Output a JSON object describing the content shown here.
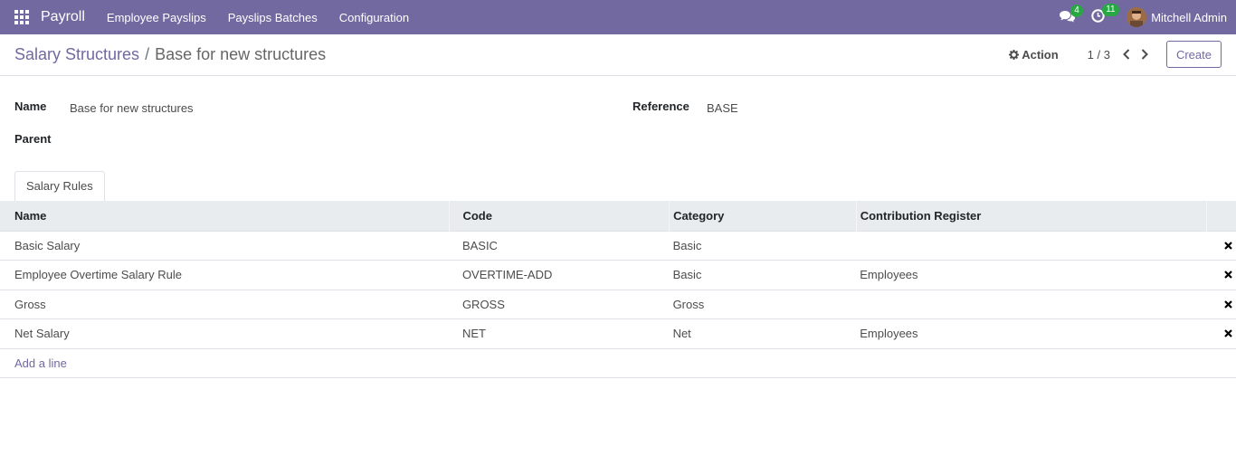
{
  "navbar": {
    "brand": "Payroll",
    "menu": [
      "Employee Payslips",
      "Payslips Batches",
      "Configuration"
    ],
    "messages_count": "4",
    "activities_count": "11",
    "user": "Mitchell Admin"
  },
  "control_panel": {
    "breadcrumb_parent": "Salary Structures",
    "breadcrumb_separator": "/",
    "breadcrumb_current": "Base for new structures",
    "action_label": "Action",
    "pager": "1 / 3",
    "create_label": "Create"
  },
  "form": {
    "name_label": "Name",
    "name_value": "Base for new structures",
    "parent_label": "Parent",
    "reference_label": "Reference",
    "reference_value": "BASE"
  },
  "tabs": [
    "Salary Rules"
  ],
  "table": {
    "columns": [
      "Name",
      "Code",
      "Category",
      "Contribution Register"
    ],
    "rows": [
      [
        "Basic Salary",
        "BASIC",
        "Basic",
        ""
      ],
      [
        "Employee Overtime Salary Rule",
        "OVERTIME-ADD",
        "Basic",
        "Employees"
      ],
      [
        "Gross",
        "GROSS",
        "Gross",
        ""
      ],
      [
        "Net Salary",
        "NET",
        "Net",
        "Employees"
      ]
    ],
    "add_line": "Add a line"
  },
  "colors": {
    "brand": "#7169a0",
    "badge": "#28a745"
  }
}
